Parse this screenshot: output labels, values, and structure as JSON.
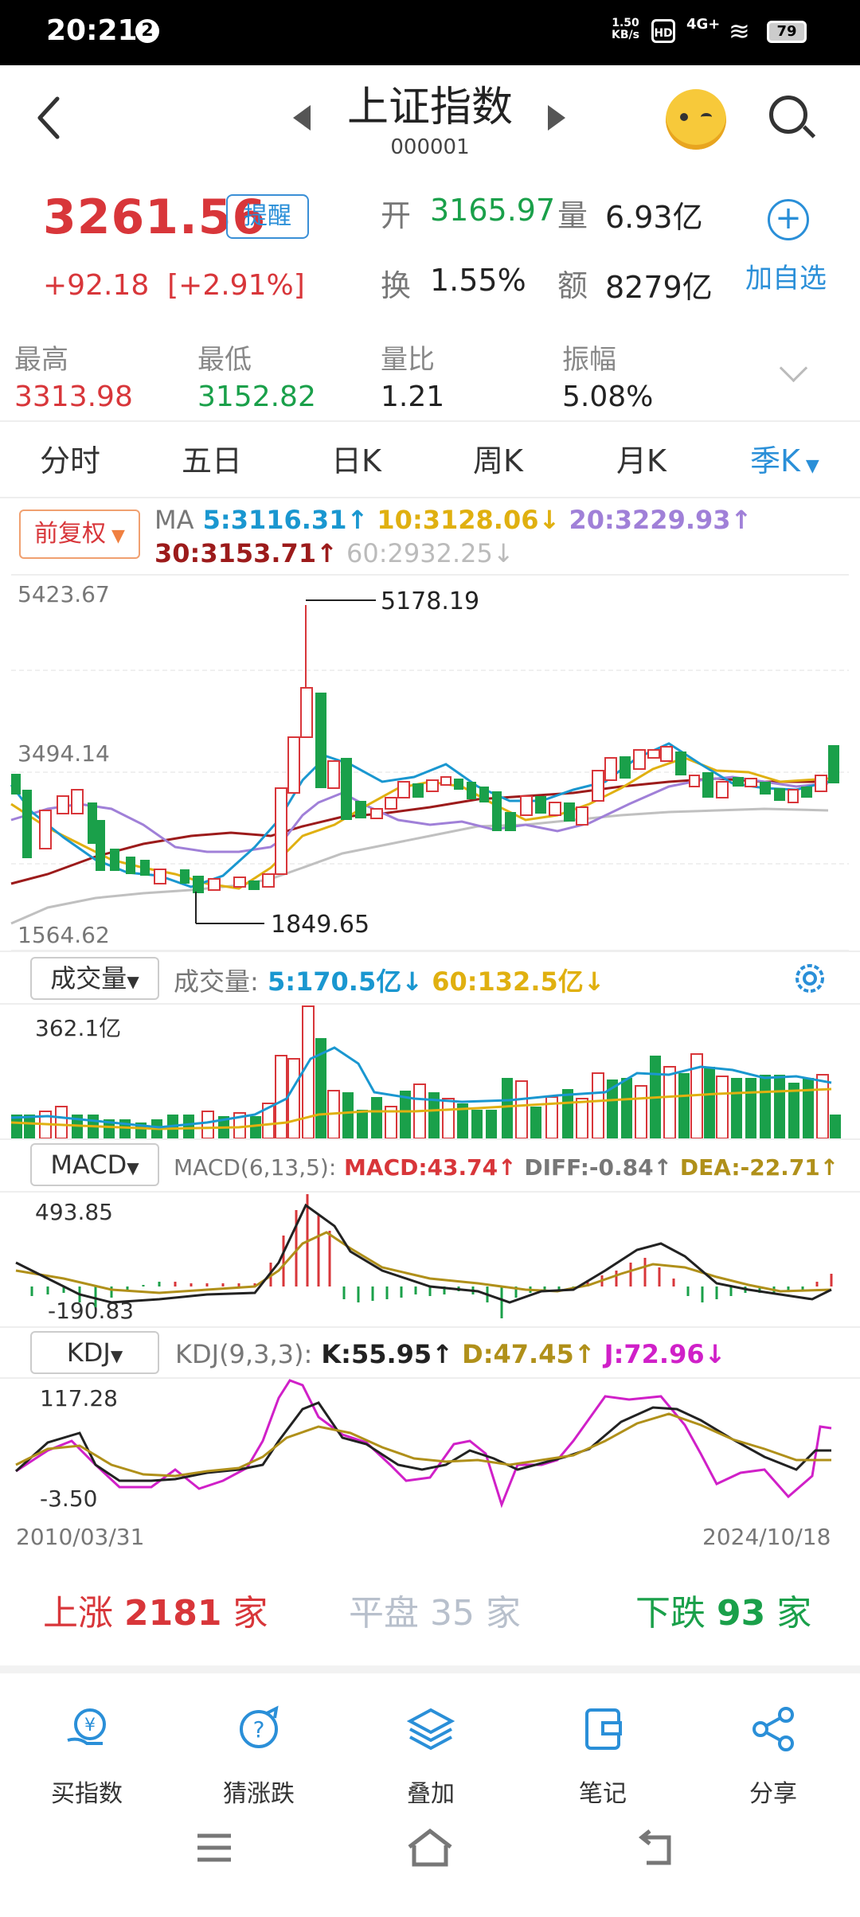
{
  "status_bar": {
    "time": "20:21",
    "notif": "2",
    "net_speed": "1.50",
    "net_unit": "KB/s",
    "hd": "HD",
    "signal": "4G+",
    "battery": "79"
  },
  "header": {
    "title": "上证指数",
    "code": "000001"
  },
  "quote": {
    "price": "3261.56",
    "alert_label": "提醒",
    "change": "+92.18",
    "change_pct": "[+2.91%]",
    "open_label": "开",
    "open_value": "3165.97",
    "volume_label": "量",
    "volume_value": "6.93亿",
    "turnover_label": "换",
    "turnover_value": "1.55%",
    "amount_label": "额",
    "amount_value": "8279亿",
    "fav_label": "加自选"
  },
  "stats": [
    {
      "label": "最高",
      "value": "3313.98"
    },
    {
      "label": "最低",
      "value": "3152.82"
    },
    {
      "label": "量比",
      "value": "1.21"
    },
    {
      "label": "振幅",
      "value": "5.08%"
    }
  ],
  "tabs": [
    {
      "label": "分时"
    },
    {
      "label": "五日"
    },
    {
      "label": "日K"
    },
    {
      "label": "周K"
    },
    {
      "label": "月K"
    },
    {
      "label": "季K"
    }
  ],
  "kline": {
    "adjust_label": "前复权",
    "ma_prefix": "MA",
    "ma5": "5:3116.31↑",
    "ma10": "10:3128.06↓",
    "ma20": "20:3229.93↑",
    "ma30": "30:3153.71↑",
    "ma60": "60:2932.25↓",
    "y_top": "5423.67",
    "y_mid": "3494.14",
    "y_bottom": "1564.62",
    "high_mark": "5178.19",
    "low_mark": "1849.65"
  },
  "volume_panel": {
    "selector": "成交量",
    "label": "成交量:",
    "v5": "5:170.5亿↓",
    "v60": "60:132.5亿↓",
    "y_top": "362.1亿"
  },
  "macd_panel": {
    "selector": "MACD",
    "params": "MACD(6,13,5):",
    "macd": "MACD:43.74↑",
    "diff": "DIFF:-0.84↑",
    "dea": "DEA:-22.71↑",
    "y_top": "493.85",
    "y_bottom": "-190.83"
  },
  "kdj_panel": {
    "selector": "KDJ",
    "params": "KDJ(9,3,3):",
    "k": "K:55.95↑",
    "d": "D:47.45↑",
    "j": "J:72.96↓",
    "y_top": "117.28",
    "y_bottom": "-3.50"
  },
  "dates": {
    "start": "2010/03/31",
    "end": "2024/10/18"
  },
  "market_breadth": {
    "up_label": "上涨",
    "up_count": "2181",
    "up_unit": "家",
    "flat_label": "平盘",
    "flat_count": "35",
    "flat_unit": "家",
    "down_label": "下跌",
    "down_count": "93",
    "down_unit": "家"
  },
  "bottom_nav": [
    {
      "label": "买指数",
      "icon": "yen-hand-icon"
    },
    {
      "label": "猜涨跌",
      "icon": "question-chart-icon"
    },
    {
      "label": "叠加",
      "icon": "layers-icon"
    },
    {
      "label": "笔记",
      "icon": "note-icon"
    },
    {
      "label": "分享",
      "icon": "share-icon"
    }
  ],
  "colors": {
    "up": "#d8363a",
    "down": "#1aa04a",
    "accent": "#2a8fd8"
  }
}
